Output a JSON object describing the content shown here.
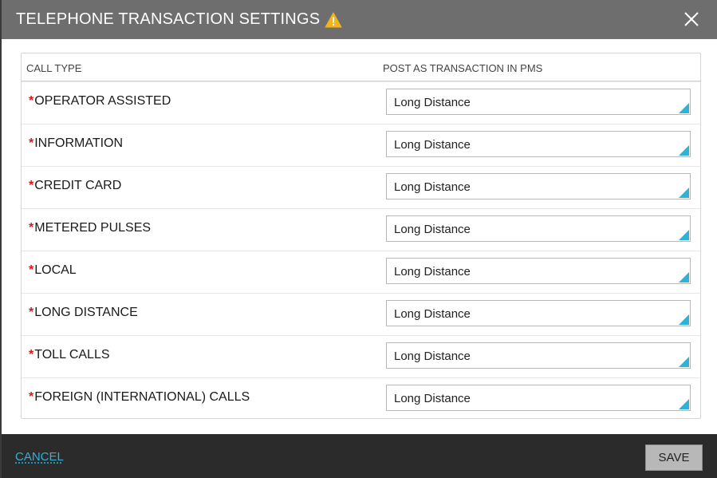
{
  "dialog": {
    "title": "TELEPHONE TRANSACTION SETTINGS",
    "warning_icon": "warning-triangle-icon",
    "close_icon": "close-icon"
  },
  "table": {
    "headers": {
      "call_type": "CALL TYPE",
      "post_as": "POST AS TRANSACTION IN PMS"
    },
    "rows": [
      {
        "required": "*",
        "label": "OPERATOR ASSISTED",
        "value": "Long Distance"
      },
      {
        "required": "*",
        "label": "INFORMATION",
        "value": "Long Distance"
      },
      {
        "required": "*",
        "label": "CREDIT CARD",
        "value": "Long Distance"
      },
      {
        "required": "*",
        "label": "METERED PULSES",
        "value": "Long Distance"
      },
      {
        "required": "*",
        "label": "LOCAL",
        "value": "Long Distance"
      },
      {
        "required": "*",
        "label": "LONG DISTANCE",
        "value": "Long Distance"
      },
      {
        "required": "*",
        "label": "TOLL CALLS",
        "value": "Long Distance"
      },
      {
        "required": "*",
        "label": "FOREIGN (INTERNATIONAL) CALLS",
        "value": "Long Distance"
      }
    ]
  },
  "footer": {
    "cancel_label": "CANCEL",
    "save_label": "SAVE"
  },
  "colors": {
    "titlebar": "#6e6e6e",
    "footer": "#2b2b2b",
    "accent": "#2fb1d8",
    "required": "#e0161b",
    "warning": "#f2b31b"
  }
}
